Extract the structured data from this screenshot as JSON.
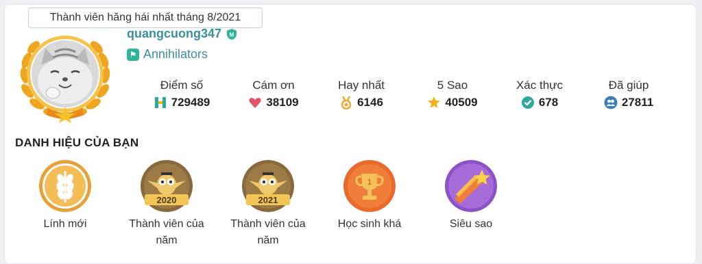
{
  "profile": {
    "month_badge": "Thành viên hăng hái nhất tháng 8/2021",
    "username": "quangcuong347",
    "mod_badge": "M",
    "team": "Annihilators"
  },
  "stats": [
    {
      "label": "Điểm số",
      "value": "729489",
      "icon": "points-icon",
      "color": "#2fa8a0"
    },
    {
      "label": "Cám ơn",
      "value": "38109",
      "icon": "heart-icon",
      "color": "#e5536b"
    },
    {
      "label": "Hay nhất",
      "value": "6146",
      "icon": "medal-icon",
      "color": "#f0a830"
    },
    {
      "label": "5 Sao",
      "value": "40509",
      "icon": "star-icon",
      "color": "#f3b21a"
    },
    {
      "label": "Xác thực",
      "value": "678",
      "icon": "verified-icon",
      "color": "#2fa8a0"
    },
    {
      "label": "Đã giúp",
      "value": "27811",
      "icon": "users-icon",
      "color": "#3d7fb5"
    }
  ],
  "section_title": "DANH HIỆU CỦA BẠN",
  "titles": [
    {
      "label": "Lính mới",
      "icon": "wheat-icon"
    },
    {
      "label": "Thành viên của năm",
      "year": "2020",
      "icon": "owl-2020-icon"
    },
    {
      "label": "Thành viên của năm",
      "year": "2021",
      "icon": "owl-2021-icon"
    },
    {
      "label": "Học sinh khá",
      "icon": "trophy-icon"
    },
    {
      "label": "Siêu sao",
      "icon": "shooting-star-icon"
    }
  ]
}
